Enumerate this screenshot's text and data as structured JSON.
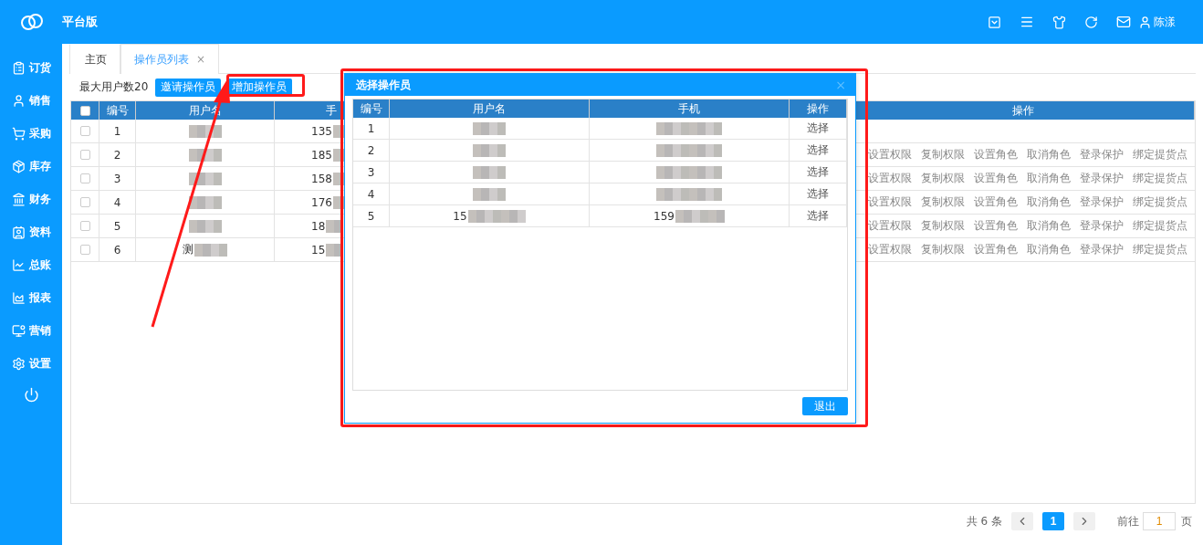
{
  "app": {
    "title": "平台版",
    "user": "陈漾"
  },
  "sidebar": [
    {
      "label": "订货"
    },
    {
      "label": "销售"
    },
    {
      "label": "采购"
    },
    {
      "label": "库存"
    },
    {
      "label": "财务"
    },
    {
      "label": "资料"
    },
    {
      "label": "总账"
    },
    {
      "label": "报表"
    },
    {
      "label": "营销"
    },
    {
      "label": "设置"
    }
  ],
  "tabs": [
    {
      "label": "主页",
      "selected": false
    },
    {
      "label": "操作员列表",
      "selected": true,
      "close": "×"
    }
  ],
  "toolbar": {
    "max_users": "最大用户数20",
    "buttons": [
      "邀请操作员",
      "增加操作员"
    ]
  },
  "table": {
    "all_checked": false,
    "columns": [
      "编号",
      "用户名",
      "手",
      "操作"
    ],
    "rows": [
      {
        "no": "1",
        "phone": "135",
        "masked": true,
        "checked": false,
        "actions": []
      },
      {
        "no": "2",
        "phone": "185",
        "masked": true,
        "checked": false,
        "actions": [
          "设置权限",
          "复制权限",
          "设置角色",
          "取消角色",
          "登录保护",
          "绑定提货点"
        ]
      },
      {
        "no": "3",
        "phone": "158",
        "masked": true,
        "checked": false,
        "actions": [
          "设置权限",
          "复制权限",
          "设置角色",
          "取消角色",
          "登录保护",
          "绑定提货点"
        ]
      },
      {
        "no": "4",
        "phone": "176",
        "masked": true,
        "checked": false,
        "actions": [
          "设置权限",
          "复制权限",
          "设置角色",
          "取消角色",
          "登录保护",
          "绑定提货点"
        ]
      },
      {
        "no": "5",
        "phone": "18",
        "masked": true,
        "checked": false,
        "actions": [
          "设置权限",
          "复制权限",
          "设置角色",
          "取消角色",
          "登录保护",
          "绑定提货点"
        ]
      },
      {
        "no": "6",
        "user": "测",
        "phone": "15",
        "masked": true,
        "checked": false,
        "actions": [
          "设置权限",
          "复制权限",
          "设置角色",
          "取消角色",
          "登录保护",
          "绑定提货点"
        ]
      }
    ]
  },
  "dialog": {
    "title": "选择操作员",
    "close": "×",
    "columns": [
      "编号",
      "用户名",
      "手机",
      "操作"
    ],
    "rows": [
      {
        "no": "1",
        "masked": true,
        "action": "选择"
      },
      {
        "no": "2",
        "masked": true,
        "action": "选择"
      },
      {
        "no": "3",
        "masked": true,
        "action": "选择"
      },
      {
        "no": "4",
        "masked": true,
        "action": "选择"
      },
      {
        "no": "5",
        "user": "15",
        "phone": "159",
        "masked": true,
        "action": "选择"
      }
    ],
    "exit": "退出"
  },
  "pagination": {
    "total": "共 6 条",
    "pages": [
      {
        "label": "1",
        "selected": true
      }
    ],
    "goto_label": "前往",
    "goto_value": "1",
    "suffix": "页"
  },
  "annotations": [
    {
      "kind": "arrow"
    },
    {
      "kind": "frame"
    },
    {
      "kind": "frame"
    }
  ]
}
